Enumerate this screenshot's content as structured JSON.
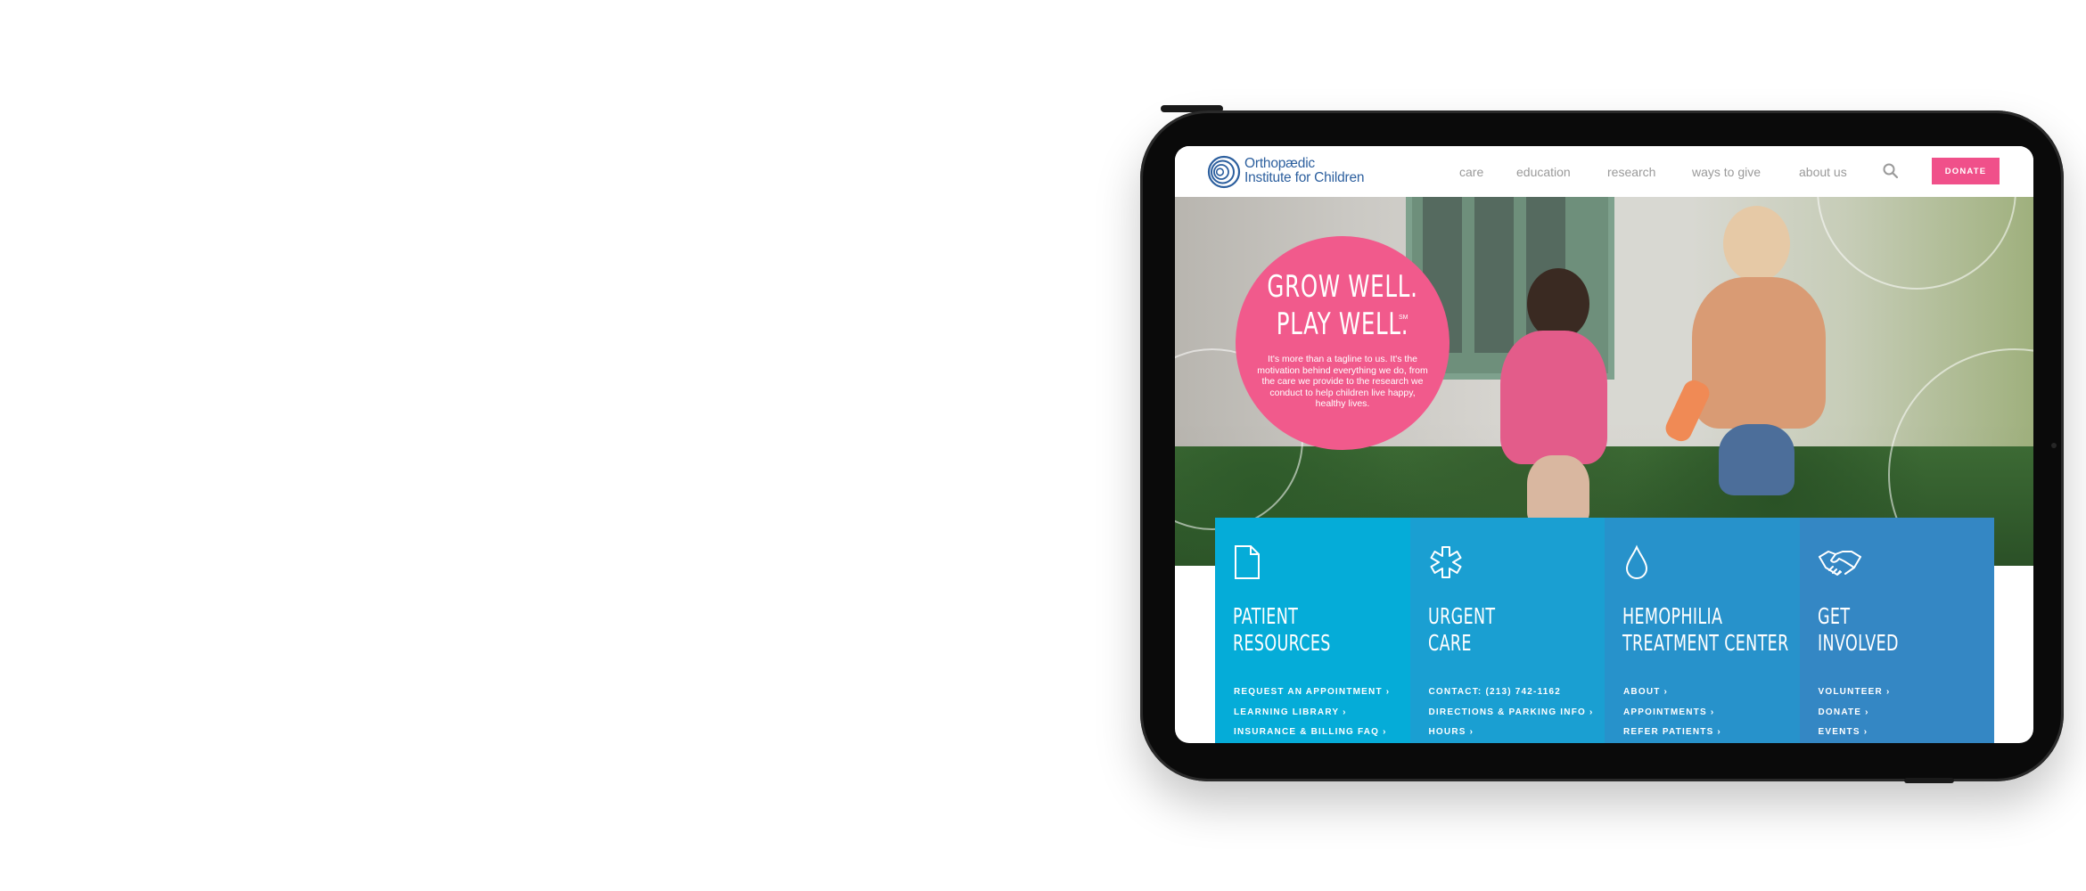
{
  "brand": {
    "name_line1": "Orthopædic",
    "name_line2": "Institute for Children",
    "logo_icon": "concentric-circles-logo",
    "color": "#2c5f9e"
  },
  "nav": {
    "items": [
      "care",
      "education",
      "research",
      "ways to give",
      "about us"
    ],
    "search_icon": "search-icon",
    "donate_label": "DONATE",
    "donate_color": "#f0508a"
  },
  "hero": {
    "headline_line1": "GROW WELL.",
    "headline_line2": "PLAY WELL.",
    "service_mark": "SM",
    "body": "It's more than a tagline to us. It's the motivation behind everything we do, from the care we provide to the research we conduct to help children live happy, healthy lives.",
    "circle_color": "#f15a8c",
    "slides_total": 4,
    "slide_active": 1
  },
  "cards": [
    {
      "icon": "document-icon",
      "title_line1": "PATIENT",
      "title_line2": "RESOURCES",
      "color": "#05acd8",
      "links": [
        "REQUEST AN APPOINTMENT ›",
        "LEARNING LIBRARY ›",
        "INSURANCE & BILLING FAQ ›"
      ]
    },
    {
      "icon": "medical-asterisk-icon",
      "title_line1": "URGENT",
      "title_line2": "CARE",
      "color": "#1a9fd2",
      "links": [
        "CONTACT: (213) 742-1162",
        "DIRECTIONS & PARKING INFO ›",
        "HOURS ›"
      ]
    },
    {
      "icon": "droplet-icon",
      "title_line1": "HEMOPHILIA",
      "title_line2": "TREATMENT CENTER",
      "color": "#2792cb",
      "links": [
        "ABOUT ›",
        "APPOINTMENTS ›",
        "REFER PATIENTS ›"
      ]
    },
    {
      "icon": "handshake-icon",
      "title_line1": "GET",
      "title_line2": "INVOLVED",
      "color": "#3487c4",
      "links": [
        "VOLUNTEER ›",
        "DONATE ›",
        "EVENTS ›"
      ]
    }
  ]
}
